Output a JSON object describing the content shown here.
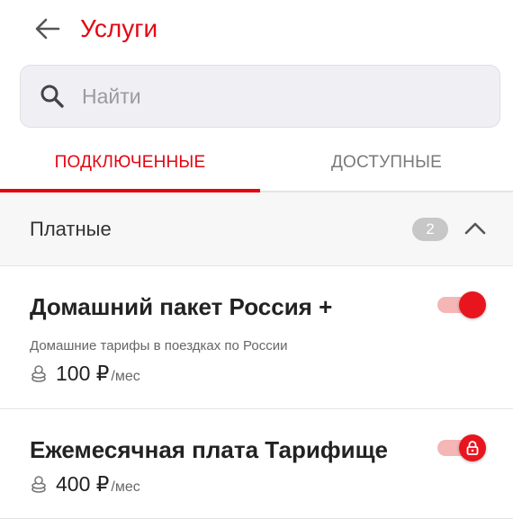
{
  "header": {
    "title": "Услуги",
    "back_icon": "arrow-left-icon"
  },
  "search": {
    "placeholder": "Найти",
    "value": "",
    "icon": "search-icon"
  },
  "tabs": [
    {
      "label": "ПОДКЛЮЧЕННЫЕ",
      "active": true
    },
    {
      "label": "ДОСТУПНЫЕ",
      "active": false
    }
  ],
  "section": {
    "title": "Платные",
    "count": "2",
    "expanded": true,
    "icon": "chevron-up-icon"
  },
  "services": [
    {
      "name": "Домашний пакет Россия +",
      "description": "Домашние тарифы в поездках по России",
      "price": "100 ₽",
      "unit": "/мес",
      "enabled": true,
      "locked": false
    },
    {
      "name": "Ежемесячная плата Тарифище",
      "description": "",
      "price": "400 ₽",
      "unit": "/мес",
      "enabled": true,
      "locked": true
    }
  ],
  "colors": {
    "accent": "#e30613",
    "toggle_track": "#f5b6b6",
    "badge": "#c7c7c7"
  }
}
